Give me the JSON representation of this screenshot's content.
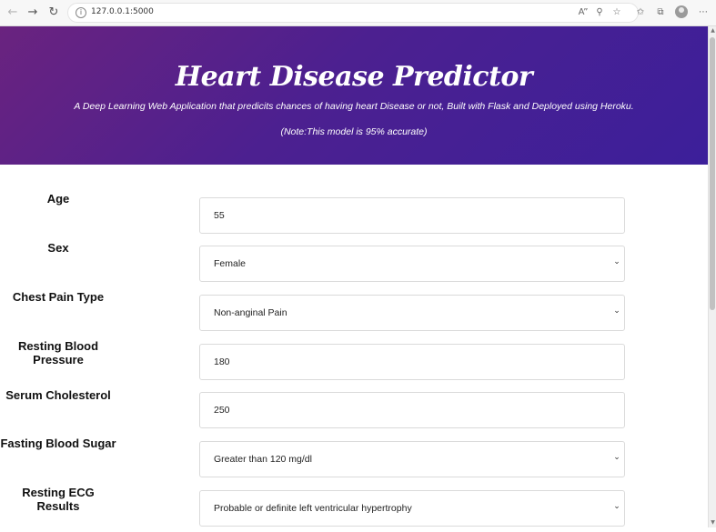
{
  "browser": {
    "url": "127.0.0.1:5000",
    "icons": {
      "back": "back-arrow-icon",
      "forward": "forward-arrow-icon",
      "refresh": "refresh-icon",
      "info": "site-info-icon",
      "read_aloud": "read-aloud-icon",
      "zoom": "zoom-icon",
      "favorite": "favorite-icon",
      "favorites": "favorites-icon",
      "collections": "collections-icon",
      "profile": "profile-avatar-icon",
      "menu": "more-menu-icon"
    }
  },
  "header": {
    "title": "Heart Disease Predictor",
    "subtitle": "A Deep Learning Web Application that predicits chances of having heart Disease or not, Built with Flask and Deployed using Heroku.",
    "note": "(Note:This model is 95% accurate)",
    "gradient_colors": [
      "#6a237f",
      "#3c1f9a"
    ]
  },
  "form": {
    "fields": [
      {
        "label": "Age",
        "type": "input",
        "value": "55"
      },
      {
        "label": "Sex",
        "type": "select",
        "value": "Female"
      },
      {
        "label": "Chest Pain Type",
        "type": "select",
        "value": "Non-anginal Pain"
      },
      {
        "label": "Resting Blood Pressure",
        "type": "input",
        "value": "180"
      },
      {
        "label": "Serum Cholesterol",
        "type": "input",
        "value": "250"
      },
      {
        "label": "Fasting Blood Sugar",
        "type": "select",
        "value": "Greater than 120 mg/dl"
      },
      {
        "label": "Resting ECG Results",
        "type": "select",
        "value": "Probable or definite left ventricular hypertrophy"
      }
    ]
  }
}
